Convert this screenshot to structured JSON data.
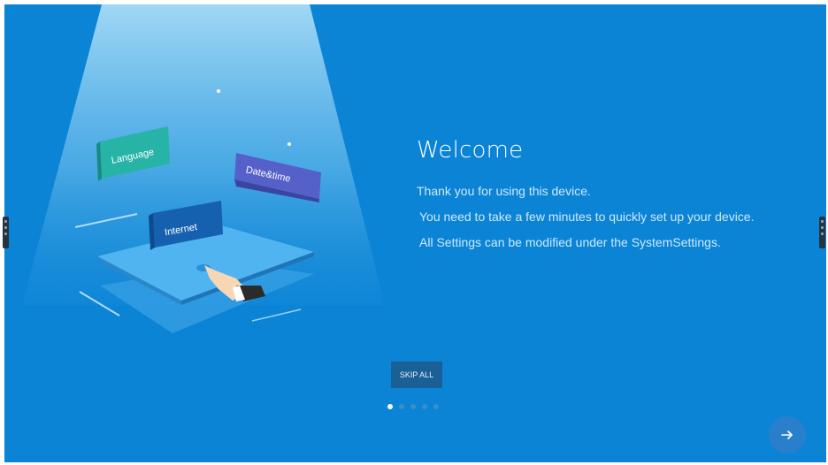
{
  "welcome": {
    "title": "Welcome",
    "lines": [
      "Thank you for using this device.",
      "You need to take a few minutes to quickly set up your device.",
      "All Settings can be modified under the SystemSettings."
    ]
  },
  "illustration": {
    "cards": [
      "Language",
      "Date&time",
      "Internet"
    ]
  },
  "controls": {
    "skip_label": "SKIP ALL",
    "page_count": 5,
    "active_page": 1
  },
  "icons": {
    "next": "arrow-right-icon"
  },
  "colors": {
    "background": "#0b84d6",
    "language_card": "#27b3a6",
    "datetime_card": "#5560c9",
    "internet_card": "#1660b0"
  }
}
